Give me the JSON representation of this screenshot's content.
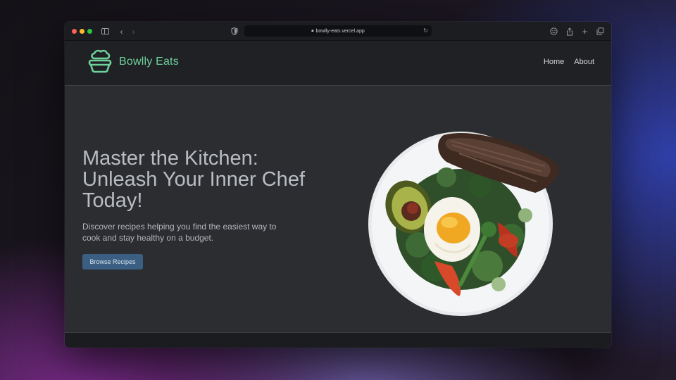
{
  "browser": {
    "url": "bowlly-eats.vercel.app"
  },
  "site": {
    "brand": "Bowlly Eats",
    "brand_color": "#6fd19a",
    "nav": [
      {
        "label": "Home"
      },
      {
        "label": "About"
      }
    ]
  },
  "hero": {
    "title": "Master the Kitchen: Unleash Your Inner Chef Today!",
    "subtitle": "Discover recipes helping you find the easiest way to cook and stay healthy on a budget.",
    "cta_label": "Browse Recipes",
    "cta_color": "#3b5f82"
  },
  "icons": {
    "logo": "chef-hat-bowl-icon",
    "lock": "lock-icon",
    "shield": "shield-icon",
    "reload": "reload-icon"
  }
}
